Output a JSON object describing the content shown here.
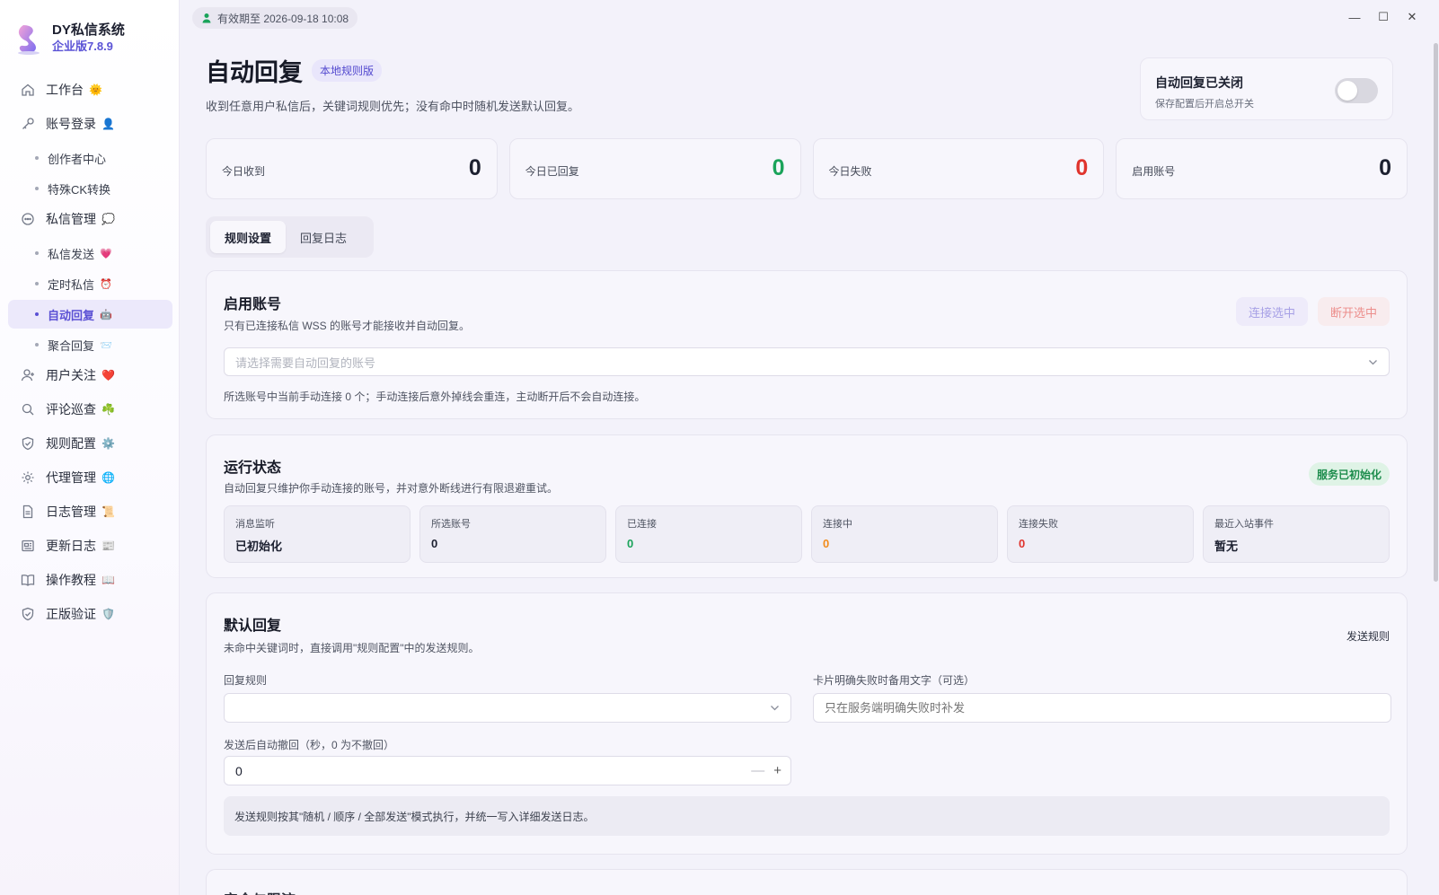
{
  "brand": {
    "name": "DY私信系统",
    "version": "企业版7.8.9"
  },
  "sidebar": {
    "items": [
      {
        "label": "工作台",
        "emoji": "🌞"
      },
      {
        "label": "账号登录",
        "emoji": "👤"
      },
      {
        "label": "创作者中心"
      },
      {
        "label": "特殊CK转换"
      },
      {
        "label": "私信管理",
        "emoji": "💭"
      },
      {
        "label": "私信发送",
        "emoji": "💗"
      },
      {
        "label": "定时私信",
        "emoji": "⏰"
      },
      {
        "label": "自动回复",
        "emoji": "🤖"
      },
      {
        "label": "聚合回复",
        "emoji": "📨"
      },
      {
        "label": "用户关注",
        "emoji": "❤️"
      },
      {
        "label": "评论巡查",
        "emoji": "☘️"
      },
      {
        "label": "规则配置",
        "emoji": "⚙️"
      },
      {
        "label": "代理管理",
        "emoji": "🌐"
      },
      {
        "label": "日志管理",
        "emoji": "📜"
      },
      {
        "label": "更新日志",
        "emoji": "📰"
      },
      {
        "label": "操作教程",
        "emoji": "📖"
      },
      {
        "label": "正版验证",
        "emoji": "🛡️"
      }
    ]
  },
  "topbar": {
    "expiry": "有效期至 2026-09-18 10:08",
    "minimize": "—",
    "maximize": "☐",
    "close": "✕"
  },
  "header": {
    "title": "自动回复",
    "badge": "本地规则版",
    "subtitle": "收到任意用户私信后，关键词规则优先；没有命中时随机发送默认回复。",
    "toggle_title": "自动回复已关闭",
    "toggle_desc": "保存配置后开启总开关",
    "toggle_on": false
  },
  "stats": [
    {
      "label": "今日收到",
      "value": "0"
    },
    {
      "label": "今日已回复",
      "value": "0"
    },
    {
      "label": "今日失败",
      "value": "0"
    },
    {
      "label": "启用账号",
      "value": "0"
    }
  ],
  "tabs": [
    "规则设置",
    "回复日志"
  ],
  "accounts": {
    "title": "启用账号",
    "desc": "只有已连接私信 WSS 的账号才能接收并自动回复。",
    "connect_label": "连接选中",
    "disconnect_label": "断开选中",
    "select_placeholder": "请选择需要自动回复的账号",
    "hint": "所选账号中当前手动连接 0 个；手动连接后意外掉线会重连，主动断开后不会自动连接。"
  },
  "status": {
    "title": "运行状态",
    "desc": "自动回复只维护你手动连接的账号，并对意外断线进行有限退避重试。",
    "badge": "服务已初始化",
    "items": [
      {
        "label": "消息监听",
        "value": "已初始化"
      },
      {
        "label": "所选账号",
        "value": "0"
      },
      {
        "label": "已连接",
        "value": "0"
      },
      {
        "label": "连接中",
        "value": "0"
      },
      {
        "label": "连接失败",
        "value": "0"
      },
      {
        "label": "最近入站事件",
        "value": "暂无"
      }
    ]
  },
  "default_reply": {
    "title": "默认回复",
    "desc": "未命中关键词时，直接调用\"规则配置\"中的发送规则。",
    "link": "发送规则",
    "rule_label": "回复规则",
    "rule_value": "",
    "fallback_label": "卡片明确失败时备用文字（可选）",
    "fallback_placeholder": "只在服务端明确失败时补发",
    "recall_label": "发送后自动撤回（秒，0 为不撤回）",
    "recall_value": "0",
    "info": "发送规则按其\"随机 / 顺序 / 全部发送\"模式执行，并统一写入详细发送日志。"
  },
  "next_card_title": "安全与限流"
}
